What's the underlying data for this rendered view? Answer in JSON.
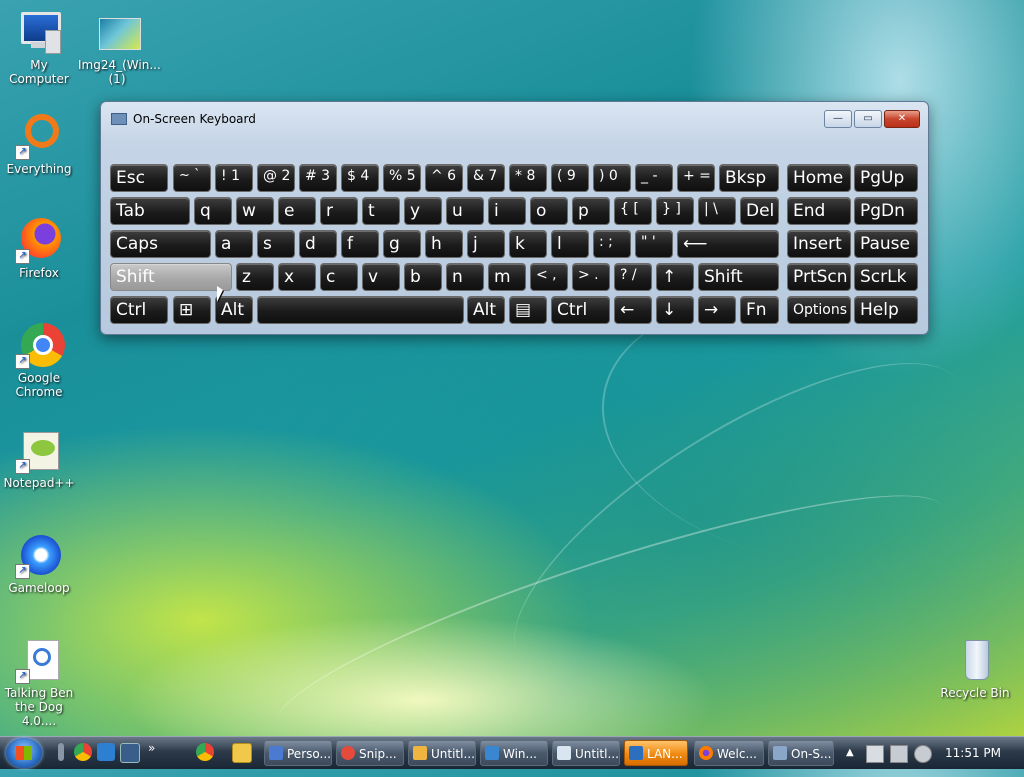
{
  "desktop": {
    "icons": [
      {
        "label": "My Computer",
        "icon": "computer-icon"
      },
      {
        "label": "Img24_(Win... (1)",
        "icon": "image-file-icon"
      },
      {
        "label": "Everything",
        "icon": "everything-icon"
      },
      {
        "label": "Firefox",
        "icon": "firefox-icon"
      },
      {
        "label": "Google Chrome",
        "icon": "chrome-icon"
      },
      {
        "label": "Notepad++",
        "icon": "notepad-plus-plus-icon"
      },
      {
        "label": "Gameloop",
        "icon": "gameloop-icon"
      },
      {
        "label": "Talking Ben the Dog 4.0....",
        "icon": "talking-ben-icon"
      },
      {
        "label": "Recycle Bin",
        "icon": "recycle-bin-icon"
      }
    ]
  },
  "osk": {
    "title": "On-Screen Keyboard",
    "buttons": {
      "minimize": "—",
      "restore": "▭",
      "close": "✕"
    },
    "rows": [
      [
        "Esc",
        "~ `",
        "! 1",
        "@ 2",
        "# 3",
        "$ 4",
        "% 5",
        "^ 6",
        "& 7",
        "* 8",
        "( 9",
        ") 0",
        "_ -",
        "+ =",
        "Bksp",
        "Home",
        "PgUp"
      ],
      [
        "Tab",
        "q",
        "w",
        "e",
        "r",
        "t",
        "y",
        "u",
        "i",
        "o",
        "p",
        "{ [",
        "} ]",
        "| \\",
        "Del",
        "End",
        "PgDn"
      ],
      [
        "Caps",
        "a",
        "s",
        "d",
        "f",
        "g",
        "h",
        "j",
        "k",
        "l",
        ": ;",
        "\" '",
        "⟵",
        "Insert",
        "Pause"
      ],
      [
        "Shift",
        "z",
        "x",
        "c",
        "v",
        "b",
        "n",
        "m",
        "< ,",
        "> .",
        "? /",
        "↑",
        "Shift",
        "PrtScn",
        "ScrLk"
      ],
      [
        "Ctrl",
        "⊞",
        "Alt",
        "",
        "Alt",
        "▤",
        "Ctrl",
        "←",
        "↓",
        "→",
        "Fn",
        "Options",
        "Help"
      ]
    ],
    "highlighted_key": "Shift"
  },
  "taskbar": {
    "items": [
      {
        "label": "Perso...",
        "icon": "personalize-icon",
        "active": false
      },
      {
        "label": "Snip...",
        "icon": "snipping-tool-icon",
        "active": false
      },
      {
        "label": "Untitl...",
        "icon": "paint-icon",
        "active": false
      },
      {
        "label": "Win...",
        "icon": "window-icon",
        "active": false
      },
      {
        "label": "Untitl...",
        "icon": "notepad-icon",
        "active": false
      },
      {
        "label": "LAN...",
        "icon": "network-icon",
        "active": true
      },
      {
        "label": "Welc...",
        "icon": "firefox-icon",
        "active": false
      },
      {
        "label": "On-S...",
        "icon": "keyboard-icon",
        "active": false
      }
    ],
    "clock": "11:51 PM"
  }
}
